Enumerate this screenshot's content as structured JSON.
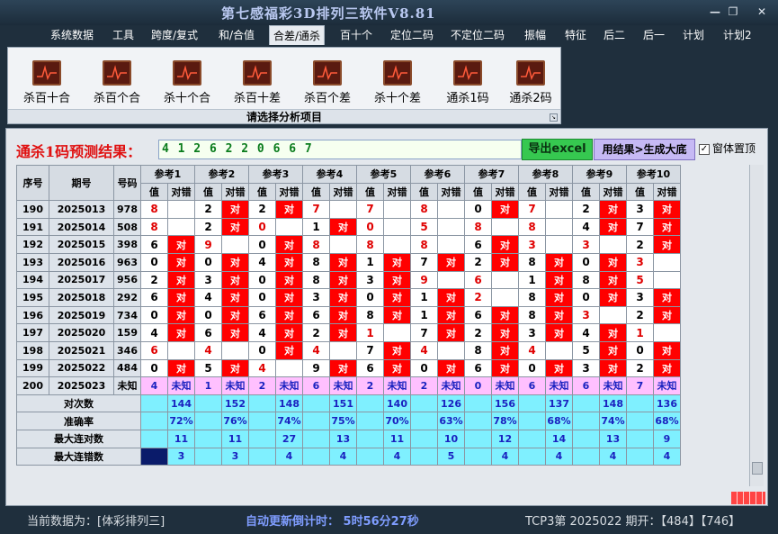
{
  "window": {
    "title": "第七感福彩3D排列三软件V8.81",
    "min_glyph": "—",
    "restore_glyph": "❐",
    "close_glyph": "✕"
  },
  "menu": [
    "系统数据",
    "工具",
    "跨度/复式",
    "和/合值",
    "合差/通杀",
    "百十个",
    "定位二码",
    "不定位二码",
    "振幅",
    "特征",
    "后二",
    "后一",
    "计划",
    "计划2"
  ],
  "menu_active_index": 4,
  "ribbon": {
    "buttons": [
      "杀百十合",
      "杀百个合",
      "杀十个合",
      "杀百十差",
      "杀百个差",
      "杀十个差",
      "通杀1码",
      "通杀2码"
    ],
    "caption": "请选择分析项目"
  },
  "result": {
    "label": "通杀1码预测结果：",
    "value": "4 1 2 6 2 2 0 6 6 7",
    "export_label": "导出excel",
    "generate_label": "用结果>生成大底",
    "ontop_label": "窗体置顶",
    "ontop_checked": true
  },
  "table": {
    "headers": {
      "idx": "序号",
      "period": "期号",
      "num": "号码",
      "val": "值",
      "res": "对错"
    },
    "refs": [
      "参考1",
      "参考2",
      "参考3",
      "参考4",
      "参考5",
      "参考6",
      "参考7",
      "参考8",
      "参考9",
      "参考10"
    ],
    "hit_label": "对",
    "rows": [
      {
        "idx": "190",
        "period": "2025013",
        "num": "978",
        "cells": [
          [
            "8",
            0
          ],
          [
            "2",
            1
          ],
          [
            "2",
            1
          ],
          [
            "7",
            0
          ],
          [
            "7",
            0
          ],
          [
            "8",
            0
          ],
          [
            "0",
            1
          ],
          [
            "7",
            0
          ],
          [
            "2",
            1
          ],
          [
            "3",
            1
          ]
        ]
      },
      {
        "idx": "191",
        "period": "2025014",
        "num": "508",
        "cells": [
          [
            "8",
            0
          ],
          [
            "2",
            1
          ],
          [
            "0",
            0
          ],
          [
            "1",
            1
          ],
          [
            "0",
            0
          ],
          [
            "5",
            0
          ],
          [
            "8",
            0
          ],
          [
            "8",
            0
          ],
          [
            "4",
            1
          ],
          [
            "7",
            1
          ]
        ]
      },
      {
        "idx": "192",
        "period": "2025015",
        "num": "398",
        "cells": [
          [
            "6",
            1
          ],
          [
            "9",
            0
          ],
          [
            "0",
            1
          ],
          [
            "8",
            0
          ],
          [
            "8",
            0
          ],
          [
            "8",
            0
          ],
          [
            "6",
            1
          ],
          [
            "3",
            0
          ],
          [
            "3",
            0
          ],
          [
            "2",
            1
          ]
        ]
      },
      {
        "idx": "193",
        "period": "2025016",
        "num": "963",
        "cells": [
          [
            "0",
            1
          ],
          [
            "0",
            1
          ],
          [
            "4",
            1
          ],
          [
            "8",
            1
          ],
          [
            "1",
            1
          ],
          [
            "7",
            1
          ],
          [
            "2",
            1
          ],
          [
            "8",
            1
          ],
          [
            "0",
            1
          ],
          [
            "3",
            0
          ]
        ]
      },
      {
        "idx": "194",
        "period": "2025017",
        "num": "956",
        "cells": [
          [
            "2",
            1
          ],
          [
            "3",
            1
          ],
          [
            "0",
            1
          ],
          [
            "8",
            1
          ],
          [
            "3",
            1
          ],
          [
            "9",
            0
          ],
          [
            "6",
            0
          ],
          [
            "1",
            1
          ],
          [
            "8",
            1
          ],
          [
            "5",
            0
          ]
        ]
      },
      {
        "idx": "195",
        "period": "2025018",
        "num": "292",
        "cells": [
          [
            "6",
            1
          ],
          [
            "4",
            1
          ],
          [
            "0",
            1
          ],
          [
            "3",
            1
          ],
          [
            "0",
            1
          ],
          [
            "1",
            1
          ],
          [
            "2",
            0
          ],
          [
            "8",
            1
          ],
          [
            "0",
            1
          ],
          [
            "3",
            1
          ]
        ]
      },
      {
        "idx": "196",
        "period": "2025019",
        "num": "734",
        "cells": [
          [
            "0",
            1
          ],
          [
            "0",
            1
          ],
          [
            "6",
            1
          ],
          [
            "6",
            1
          ],
          [
            "8",
            1
          ],
          [
            "1",
            1
          ],
          [
            "6",
            1
          ],
          [
            "8",
            1
          ],
          [
            "3",
            0
          ],
          [
            "2",
            1
          ]
        ]
      },
      {
        "idx": "197",
        "period": "2025020",
        "num": "159",
        "cells": [
          [
            "4",
            1
          ],
          [
            "6",
            1
          ],
          [
            "4",
            1
          ],
          [
            "2",
            1
          ],
          [
            "1",
            0
          ],
          [
            "7",
            1
          ],
          [
            "2",
            1
          ],
          [
            "3",
            1
          ],
          [
            "4",
            1
          ],
          [
            "1",
            0
          ]
        ]
      },
      {
        "idx": "198",
        "period": "2025021",
        "num": "346",
        "cells": [
          [
            "6",
            0
          ],
          [
            "4",
            0
          ],
          [
            "0",
            1
          ],
          [
            "4",
            0
          ],
          [
            "7",
            1
          ],
          [
            "4",
            0
          ],
          [
            "8",
            1
          ],
          [
            "4",
            0
          ],
          [
            "5",
            1
          ],
          [
            "0",
            1
          ]
        ]
      },
      {
        "idx": "199",
        "period": "2025022",
        "num": "484",
        "cells": [
          [
            "0",
            1
          ],
          [
            "5",
            1
          ],
          [
            "4",
            0
          ],
          [
            "9",
            1
          ],
          [
            "6",
            1
          ],
          [
            "0",
            1
          ],
          [
            "6",
            1
          ],
          [
            "0",
            1
          ],
          [
            "3",
            1
          ],
          [
            "2",
            1
          ]
        ]
      }
    ],
    "prediction": {
      "idx": "200",
      "period": "2025023",
      "num": "未知",
      "values": [
        "4",
        "1",
        "2",
        "6",
        "2",
        "2",
        "0",
        "6",
        "6",
        "7"
      ],
      "unknown": "未知"
    },
    "stats": [
      {
        "label": "对次数",
        "values": [
          "144",
          "152",
          "148",
          "151",
          "140",
          "126",
          "156",
          "137",
          "148",
          "136"
        ]
      },
      {
        "label": "准确率",
        "values": [
          "72%",
          "76%",
          "74%",
          "75%",
          "70%",
          "63%",
          "78%",
          "68%",
          "74%",
          "68%"
        ]
      },
      {
        "label": "最大连对数",
        "values": [
          "11",
          "11",
          "27",
          "13",
          "11",
          "10",
          "12",
          "14",
          "13",
          "9"
        ]
      },
      {
        "label": "最大连错数",
        "values": [
          "3",
          "3",
          "4",
          "4",
          "4",
          "5",
          "4",
          "4",
          "4",
          "4"
        ]
      }
    ]
  },
  "status": {
    "source": "当前数据为：[体彩排列三]",
    "countdown": "自动更新倒计时：  5时56分27秒",
    "period": "TCP3第 2025022 期开：【484】【746】"
  }
}
